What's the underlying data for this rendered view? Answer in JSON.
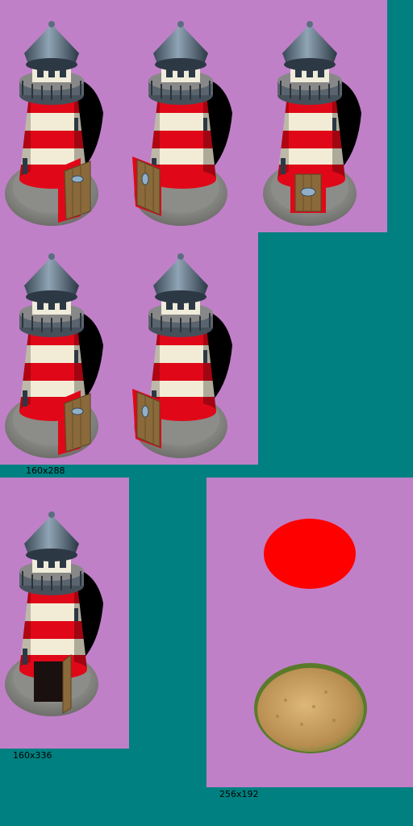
{
  "labels": {
    "sheet_a": "160x288",
    "sheet_b": "160x336",
    "sheet_c": "256x192"
  },
  "colors": {
    "background": "#008080",
    "panel": "#c080c8",
    "stripe_red": "#e00818",
    "stripe_white": "#f2ecd6",
    "roof": "#5a6e80",
    "stone": "#9a9a96",
    "door": "#8a6a3a",
    "marker": "#ff0000",
    "sand": "#c8a060"
  },
  "icons": [
    "lighthouse-sprite",
    "red-marker",
    "sand-patch"
  ]
}
